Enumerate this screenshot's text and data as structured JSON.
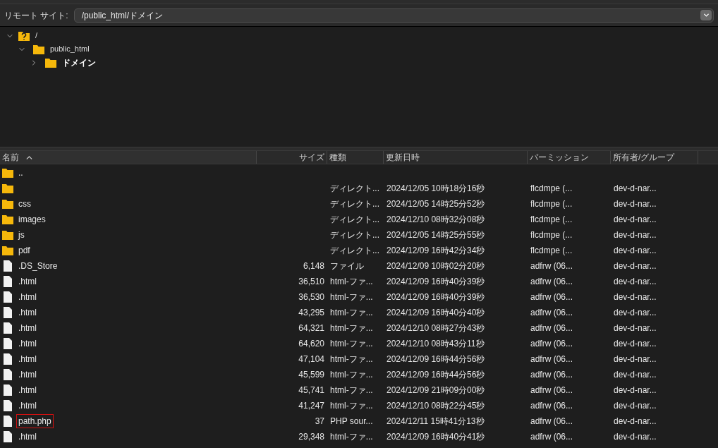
{
  "remote_site": {
    "label": "リモート サイト:",
    "value": "/public_html/ドメイン"
  },
  "tree": [
    {
      "label": "/",
      "expanded": true,
      "bold": false,
      "children": [
        {
          "label": "public_html",
          "expanded": true,
          "bold": false,
          "children": [
            {
              "label": "ドメイン",
              "expanded": false,
              "bold": true
            }
          ]
        }
      ]
    }
  ],
  "table": {
    "columns": [
      {
        "label": "名前",
        "sorted": true
      },
      {
        "label": "サイズ",
        "sorted": false
      },
      {
        "label": "種類",
        "sorted": false
      },
      {
        "label": "更新日時",
        "sorted": false
      },
      {
        "label": "パーミッション",
        "sorted": false
      },
      {
        "label": "所有者/グループ",
        "sorted": false
      }
    ],
    "rows": [
      {
        "kind": "folder",
        "name": ".."
      },
      {
        "kind": "folder",
        "type": "ディレクト...",
        "modified": "2024/12/05 10時18分16秒",
        "permissions": "flcdmpe (...",
        "owner": "dev-d-nar..."
      },
      {
        "kind": "folder",
        "name": "css",
        "type": "ディレクト...",
        "modified": "2024/12/05 14時25分52秒",
        "permissions": "flcdmpe (...",
        "owner": "dev-d-nar..."
      },
      {
        "kind": "folder",
        "name": "images",
        "type": "ディレクト...",
        "modified": "2024/12/10 08時32分08秒",
        "permissions": "flcdmpe (...",
        "owner": "dev-d-nar..."
      },
      {
        "kind": "folder",
        "name": "js",
        "type": "ディレクト...",
        "modified": "2024/12/05 14時25分55秒",
        "permissions": "flcdmpe (...",
        "owner": "dev-d-nar..."
      },
      {
        "kind": "folder",
        "name": "pdf",
        "type": "ディレクト...",
        "modified": "2024/12/09 16時42分34秒",
        "permissions": "flcdmpe (...",
        "owner": "dev-d-nar..."
      },
      {
        "kind": "file",
        "name": ".DS_Store",
        "size": "6,148",
        "type": "ファイル",
        "modified": "2024/12/09 10時02分20秒",
        "permissions": "adfrw (06...",
        "owner": "dev-d-nar..."
      },
      {
        "kind": "file",
        "name": ".html",
        "size": "36,510",
        "type": "html-ファ...",
        "modified": "2024/12/09 16時40分39秒",
        "permissions": "adfrw (06...",
        "owner": "dev-d-nar..."
      },
      {
        "kind": "file",
        "name": ".html",
        "size": "36,530",
        "type": "html-ファ...",
        "modified": "2024/12/09 16時40分39秒",
        "permissions": "adfrw (06...",
        "owner": "dev-d-nar..."
      },
      {
        "kind": "file",
        "name": ".html",
        "size": "43,295",
        "type": "html-ファ...",
        "modified": "2024/12/09 16時40分40秒",
        "permissions": "adfrw (06...",
        "owner": "dev-d-nar..."
      },
      {
        "kind": "file",
        "name": ".html",
        "size": "64,321",
        "type": "html-ファ...",
        "modified": "2024/12/10 08時27分43秒",
        "permissions": "adfrw (06...",
        "owner": "dev-d-nar..."
      },
      {
        "kind": "file",
        "name": ".html",
        "size": "64,620",
        "type": "html-ファ...",
        "modified": "2024/12/10 08時43分11秒",
        "permissions": "adfrw (06...",
        "owner": "dev-d-nar..."
      },
      {
        "kind": "file",
        "name": ".html",
        "size": "47,104",
        "type": "html-ファ...",
        "modified": "2024/12/09 16時44分56秒",
        "permissions": "adfrw (06...",
        "owner": "dev-d-nar..."
      },
      {
        "kind": "file",
        "name": ".html",
        "size": "45,599",
        "type": "html-ファ...",
        "modified": "2024/12/09 16時44分56秒",
        "permissions": "adfrw (06...",
        "owner": "dev-d-nar..."
      },
      {
        "kind": "file",
        "name": ".html",
        "size": "45,741",
        "type": "html-ファ...",
        "modified": "2024/12/09 21時09分00秒",
        "permissions": "adfrw (06...",
        "owner": "dev-d-nar..."
      },
      {
        "kind": "file",
        "name": ".html",
        "size": "41,247",
        "type": "html-ファ...",
        "modified": "2024/12/10 08時22分45秒",
        "permissions": "adfrw (06...",
        "owner": "dev-d-nar..."
      },
      {
        "kind": "file",
        "name": "path.php",
        "size": "37",
        "type": "PHP sour...",
        "modified": "2024/12/11 15時41分13秒",
        "permissions": "adfrw (06...",
        "owner": "dev-d-nar...",
        "highlighted": true
      },
      {
        "kind": "file",
        "name": ".html",
        "size": "29,348",
        "type": "html-ファ...",
        "modified": "2024/12/09 16時40分41秒",
        "permissions": "adfrw (06...",
        "owner": "dev-d-nar..."
      }
    ]
  }
}
